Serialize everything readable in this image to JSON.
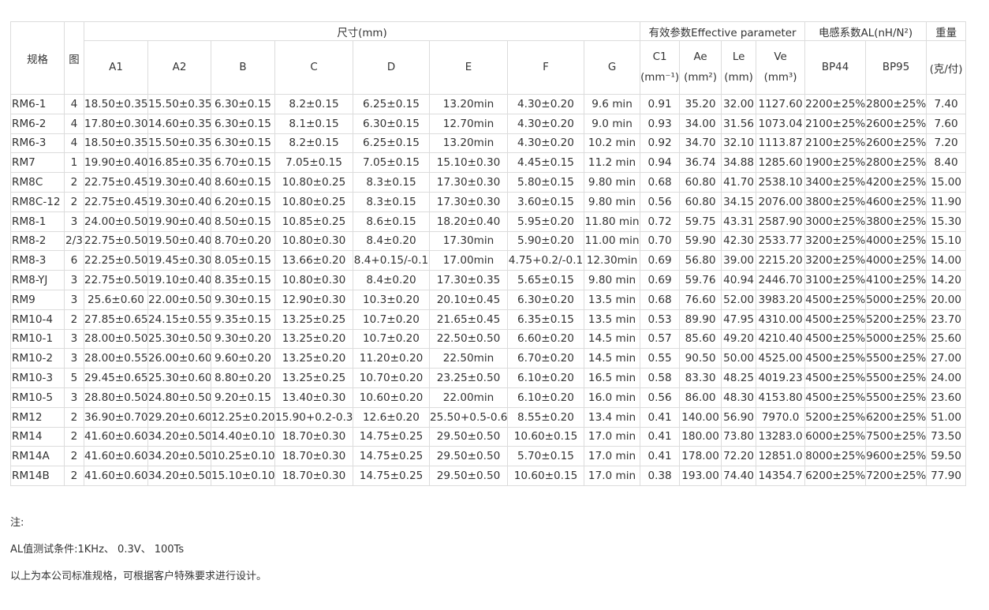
{
  "headers": {
    "spec": "规格",
    "fig": "图",
    "size_group": "尺寸(mm)",
    "eff_group": "有效参数Effective parameter",
    "al_group": "电感系数AL(nH/N²)",
    "weight_group": "重量",
    "dims": [
      "A1",
      "A2",
      "B",
      "C",
      "D",
      "E",
      "F",
      "G"
    ],
    "eff": [
      {
        "name": "C1",
        "unit": "(mm⁻¹)"
      },
      {
        "name": "Ae",
        "unit": "(mm²)"
      },
      {
        "name": "Le",
        "unit": "(mm)"
      },
      {
        "name": "Ve",
        "unit": "(mm³)"
      }
    ],
    "al": [
      "BP44",
      "BP95"
    ],
    "weight_unit": "(克/付)"
  },
  "rows": [
    [
      "RM6-1",
      "4",
      "18.50±0.35",
      "15.50±0.35",
      "6.30±0.15",
      "8.2±0.15",
      "6.25±0.15",
      "13.20min",
      "4.30±0.20",
      "9.6 min",
      "0.91",
      "35.20",
      "32.00",
      "1127.60",
      "2200±25%",
      "2800±25%",
      "7.40"
    ],
    [
      "RM6-2",
      "4",
      "17.80±0.30",
      "14.60±0.35",
      "6.30±0.15",
      "8.1±0.15",
      "6.30±0.15",
      "12.70min",
      "4.30±0.20",
      "9.0 min",
      "0.93",
      "34.00",
      "31.56",
      "1073.04",
      "2100±25%",
      "2600±25%",
      "7.60"
    ],
    [
      "RM6-3",
      "4",
      "18.50±0.35",
      "15.50±0.35",
      "6.30±0.15",
      "8.2±0.15",
      "6.25±0.15",
      "13.20min",
      "4.30±0.20",
      "10.2 min",
      "0.92",
      "34.70",
      "32.10",
      "1113.87",
      "2100±25%",
      "2600±25%",
      "7.20"
    ],
    [
      "RM7",
      "1",
      "19.90±0.40",
      "16.85±0.35",
      "6.70±0.15",
      "7.05±0.15",
      "7.05±0.15",
      "15.10±0.30",
      "4.45±0.15",
      "11.2 min",
      "0.94",
      "36.74",
      "34.88",
      "1285.60",
      "1900±25%",
      "2800±25%",
      "8.40"
    ],
    [
      "RM8C",
      "2",
      "22.75±0.45",
      "19.30±0.40",
      "8.60±0.15",
      "10.80±0.25",
      "8.3±0.15",
      "17.30±0.30",
      "5.80±0.15",
      "9.80 min",
      "0.68",
      "60.80",
      "41.70",
      "2538.10",
      "3400±25%",
      "4200±25%",
      "15.00"
    ],
    [
      "RM8C-12",
      "2",
      "22.75±0.45",
      "19.30±0.40",
      "6.20±0.15",
      "10.80±0.25",
      "8.3±0.15",
      "17.30±0.30",
      "3.60±0.15",
      "9.80 min",
      "0.56",
      "60.80",
      "34.15",
      "2076.00",
      "3800±25%",
      "4600±25%",
      "11.90"
    ],
    [
      "RM8-1",
      "3",
      "24.00±0.50",
      "19.90±0.40",
      "8.50±0.15",
      "10.85±0.25",
      "8.6±0.15",
      "18.20±0.40",
      "5.95±0.20",
      "11.80 min",
      "0.72",
      "59.75",
      "43.31",
      "2587.90",
      "3000±25%",
      "3800±25%",
      "15.30"
    ],
    [
      "RM8-2",
      "2/3",
      "22.75±0.50",
      "19.50±0.40",
      "8.70±0.20",
      "10.80±0.30",
      "8.4±0.20",
      "17.30min",
      "5.90±0.20",
      "11.00 min",
      "0.70",
      "59.90",
      "42.30",
      "2533.77",
      "3200±25%",
      "4000±25%",
      "15.10"
    ],
    [
      "RM8-3",
      "6",
      "22.25±0.50",
      "19.45±0.30",
      "8.05±0.15",
      "13.66±0.20",
      "8.4+0.15/-0.1",
      "17.00min",
      "4.75+0.2/-0.1",
      "12.30min",
      "0.69",
      "56.80",
      "39.00",
      "2215.20",
      "3200±25%",
      "4000±25%",
      "14.00"
    ],
    [
      "RM8-YJ",
      "3",
      "22.75±0.50",
      "19.10±0.40",
      "8.35±0.15",
      "10.80±0.30",
      "8.4±0.20",
      "17.30±0.35",
      "5.65±0.15",
      "9.80 min",
      "0.69",
      "59.76",
      "40.94",
      "2446.70",
      "3100±25%",
      "4100±25%",
      "14.20"
    ],
    [
      "RM9",
      "3",
      "25.6±0.60",
      "22.00±0.50",
      "9.30±0.15",
      "12.90±0.30",
      "10.3±0.20",
      "20.10±0.45",
      "6.30±0.20",
      "13.5 min",
      "0.68",
      "76.60",
      "52.00",
      "3983.20",
      "4500±25%",
      "5000±25%",
      "20.00"
    ],
    [
      "RM10-4",
      "2",
      "27.85±0.65",
      "24.15±0.55",
      "9.35±0.15",
      "13.25±0.25",
      "10.7±0.20",
      "21.65±0.45",
      "6.35±0.15",
      "13.5 min",
      "0.53",
      "89.90",
      "47.95",
      "4310.00",
      "4500±25%",
      "5200±25%",
      "23.70"
    ],
    [
      "RM10-1",
      "3",
      "28.00±0.50",
      "25.30±0.50",
      "9.30±0.20",
      "13.25±0.20",
      "10.7±0.20",
      "22.50±0.50",
      "6.60±0.20",
      "14.5 min",
      "0.57",
      "85.60",
      "49.20",
      "4210.40",
      "4500±25%",
      "5000±25%",
      "25.60"
    ],
    [
      "RM10-2",
      "3",
      "28.00±0.55",
      "26.00±0.60",
      "9.60±0.20",
      "13.25±0.20",
      "11.20±0.20",
      "22.50min",
      "6.70±0.20",
      "14.5 min",
      "0.55",
      "90.50",
      "50.00",
      "4525.00",
      "4500±25%",
      "5500±25%",
      "27.00"
    ],
    [
      "RM10-3",
      "5",
      "29.45±0.65",
      "25.30±0.60",
      "8.80±0.20",
      "13.25±0.25",
      "10.70±0.20",
      "23.25±0.50",
      "6.10±0.20",
      "16.5 min",
      "0.58",
      "83.30",
      "48.25",
      "4019.23",
      "4500±25%",
      "5500±25%",
      "24.00"
    ],
    [
      "RM10-5",
      "3",
      "28.80±0.50",
      "24.80±0.50",
      "9.20±0.15",
      "13.40±0.30",
      "10.60±0.20",
      "22.00min",
      "6.10±0.20",
      "16.0 min",
      "0.56",
      "86.00",
      "48.30",
      "4153.80",
      "4500±25%",
      "5500±25%",
      "23.60"
    ],
    [
      "RM12",
      "2",
      "36.90±0.70",
      "29.20±0.60",
      "12.25±0.20",
      "15.90+0.2-0.3",
      "12.6±0.20",
      "25.50+0.5-0.6",
      "8.55±0.20",
      "13.4 min",
      "0.41",
      "140.00",
      "56.90",
      "7970.0",
      "5200±25%",
      "6200±25%",
      "51.00"
    ],
    [
      "RM14",
      "2",
      "41.60±0.60",
      "34.20±0.50",
      "14.40±0.10",
      "18.70±0.30",
      "14.75±0.25",
      "29.50±0.50",
      "10.60±0.15",
      "17.0 min",
      "0.41",
      "180.00",
      "73.80",
      "13283.0",
      "6000±25%",
      "7500±25%",
      "73.50"
    ],
    [
      "RM14A",
      "2",
      "41.60±0.60",
      "34.20±0.50",
      "10.25±0.10",
      "18.70±0.30",
      "14.75±0.25",
      "29.50±0.50",
      "5.70±0.15",
      "17.0 min",
      "0.41",
      "178.00",
      "72.20",
      "12851.0",
      "8000±25%",
      "9600±25%",
      "59.50"
    ],
    [
      "RM14B",
      "2",
      "41.60±0.60",
      "34.20±0.50",
      "15.10±0.10",
      "18.70±0.30",
      "14.75±0.25",
      "29.50±0.50",
      "10.60±0.15",
      "17.0 min",
      "0.38",
      "193.00",
      "74.40",
      "14354.7",
      "6200±25%",
      "7200±25%",
      "77.90"
    ]
  ],
  "notes": {
    "title": "注:",
    "al_condition": "AL值测试条件:1KHz、 0.3V、 100Ts",
    "standard": "以上为本公司标准规格，可根据客户特殊要求进行设计。"
  }
}
